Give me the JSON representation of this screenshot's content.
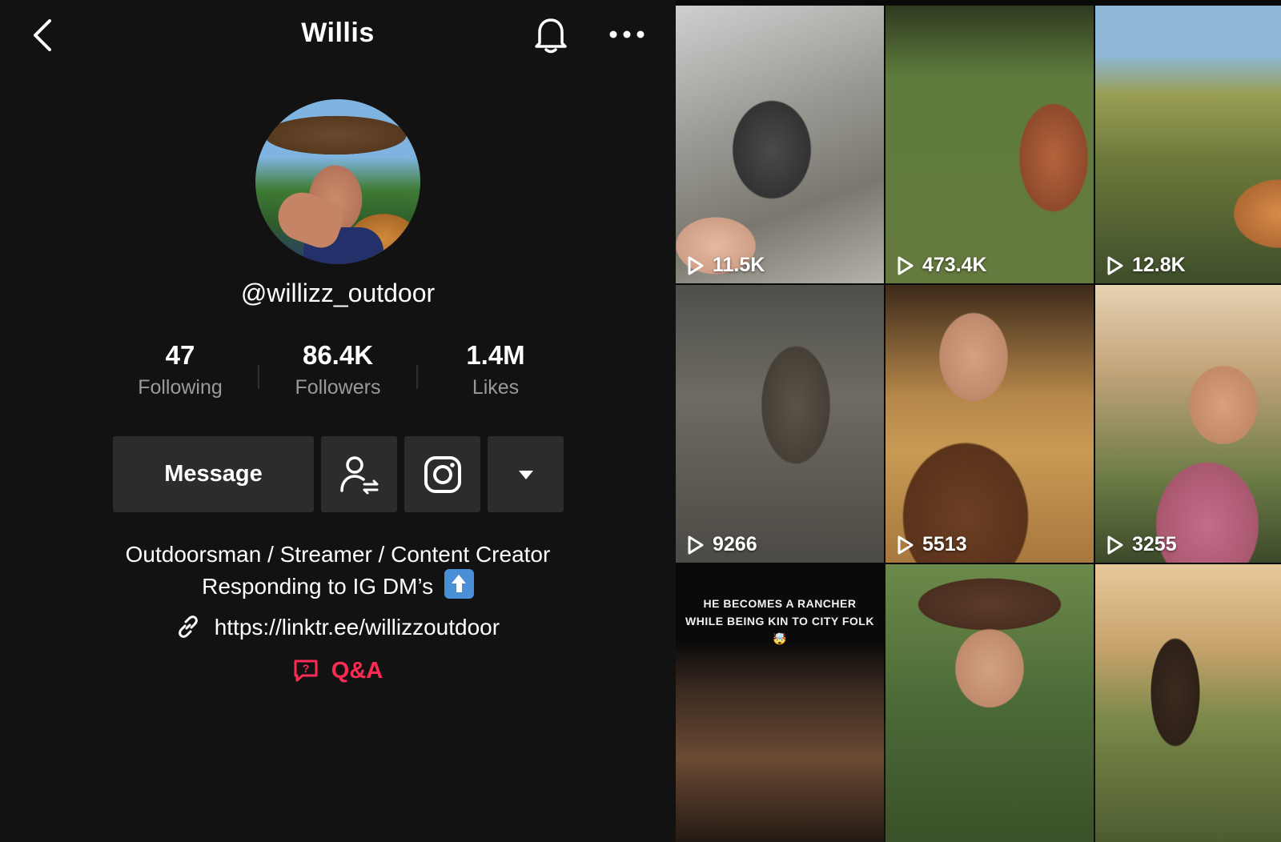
{
  "header": {
    "title": "Willis",
    "back_icon": "chevron-left-icon",
    "bell_icon": "bell-icon",
    "more_icon": "more-horizontal-icon"
  },
  "profile": {
    "handle": "@willizz_outdoor",
    "stats": [
      {
        "value": "47",
        "label": "Following"
      },
      {
        "value": "86.4K",
        "label": "Followers"
      },
      {
        "value": "1.4M",
        "label": "Likes"
      }
    ],
    "buttons": {
      "message_label": "Message",
      "follow_icon": "user-follow-icon",
      "instagram_icon": "instagram-icon",
      "dropdown_icon": "caret-down-icon"
    },
    "bio_line1": "Outdoorsman / Streamer / Content Creator",
    "bio_line2": "Responding to IG DM’s",
    "bio_emoji": "up-arrow-icon",
    "link": "https://linktr.ee/willizzoutdoor",
    "link_icon": "link-icon",
    "qa_label": "Q&A",
    "qa_icon": "question-chat-icon"
  },
  "videos": [
    {
      "views": "11.5K"
    },
    {
      "views": "473.4K"
    },
    {
      "views": "12.8K"
    },
    {
      "views": "9266"
    },
    {
      "views": "5513"
    },
    {
      "views": "3255"
    },
    {
      "caption": "HE BECOMES A RANCHER WHILE BEING KIN TO CITY FOLK 🤯"
    },
    {},
    {}
  ],
  "colors": {
    "background": "#121212",
    "button": "#2c2c2c",
    "accent": "#fe2c55",
    "muted_text": "#9a9a9a"
  }
}
